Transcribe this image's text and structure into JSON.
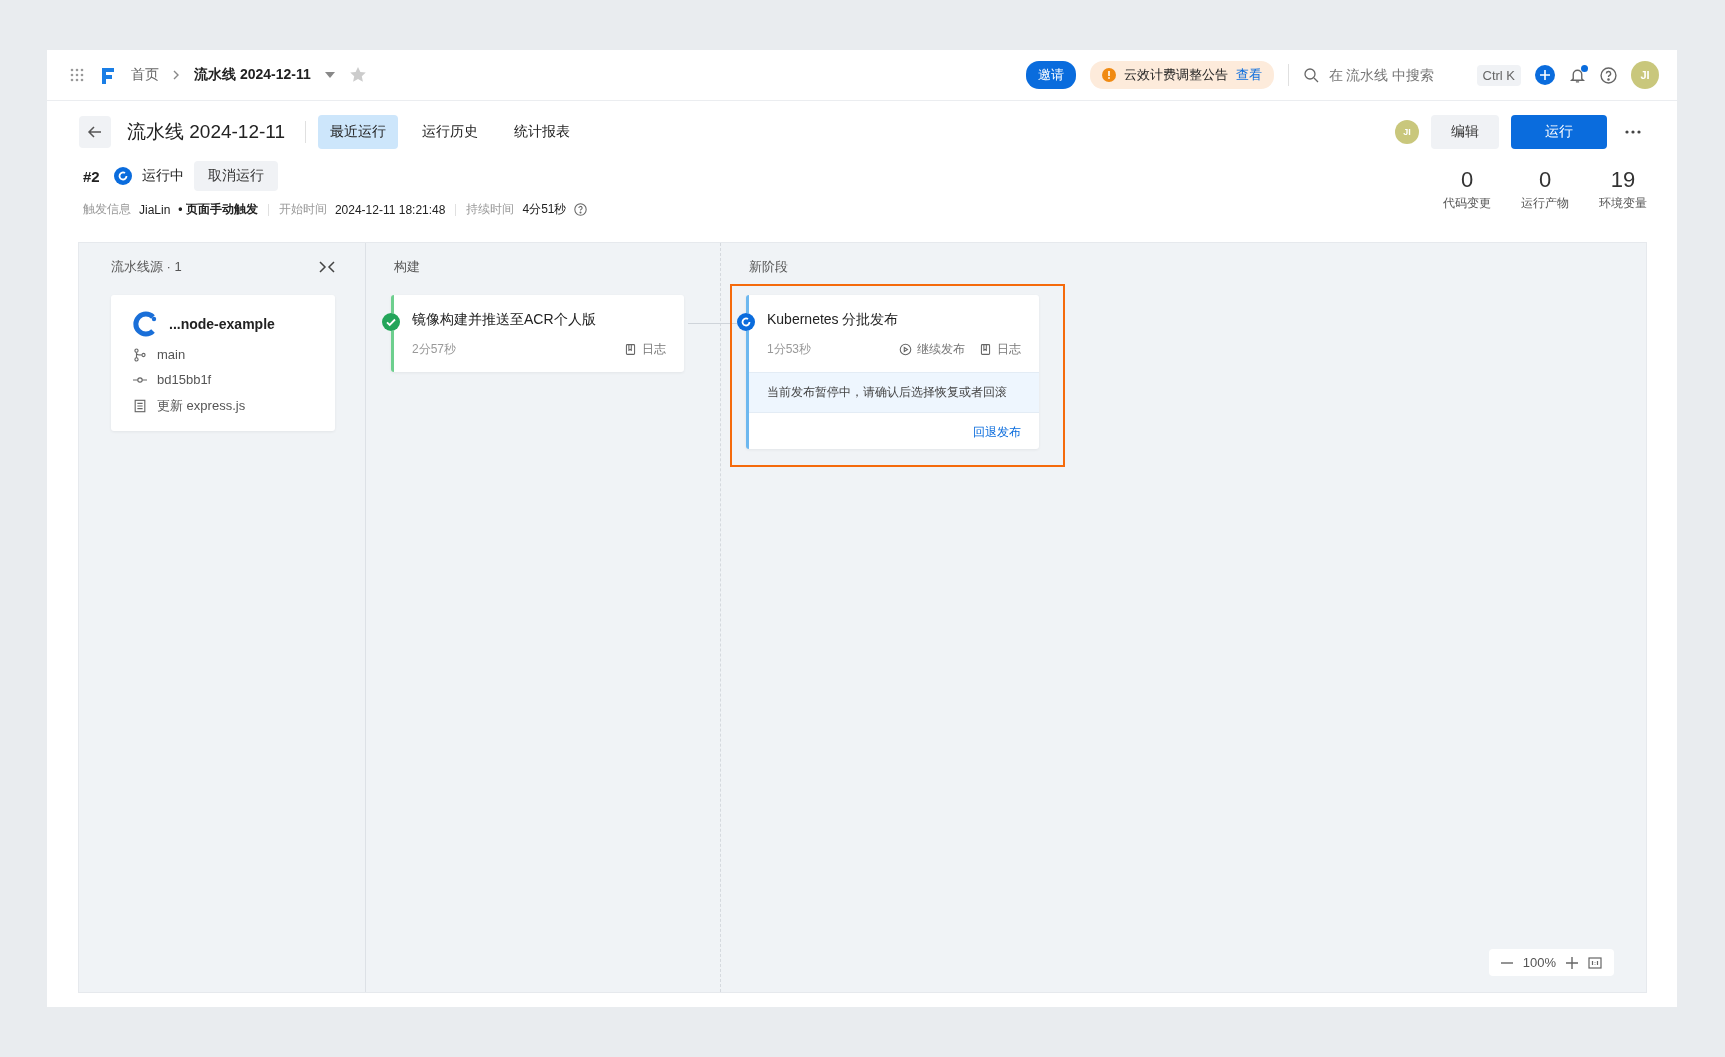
{
  "topbar": {
    "breadcrumb": [
      {
        "text": "首页"
      },
      {
        "text": "流水线 2024-12-11"
      }
    ],
    "invite": "邀请",
    "notice": {
      "text": "云效计费调整公告",
      "link": "查看"
    },
    "search": {
      "placeholder": "在 流水线 中搜索"
    },
    "shortcut": "Ctrl K",
    "bell_unread": true,
    "avatar": "JI"
  },
  "header": {
    "title": "流水线 2024-12-11",
    "tabs": [
      {
        "label": "最近运行",
        "selected": true
      },
      {
        "label": "运行历史",
        "selected": false
      },
      {
        "label": "统计报表",
        "selected": false
      }
    ],
    "avatar": "JI",
    "edit": "编辑",
    "run": "运行"
  },
  "run": {
    "number": "#2",
    "status": "运行中",
    "cancel": "取消运行",
    "trigger": {
      "label": "触发信息",
      "user": "JiaLin",
      "method": "• 页面手动触发"
    },
    "start": {
      "label": "开始时间",
      "value": "2024-12-11 18:21:48"
    },
    "duration": {
      "label": "持续时间",
      "value": "4分51秒"
    }
  },
  "stats": [
    {
      "value": "0",
      "label": "代码变更"
    },
    {
      "value": "0",
      "label": "运行产物"
    },
    {
      "value": "19",
      "label": "环境变量"
    }
  ],
  "source": {
    "title": "流水线源 · 1",
    "repo": "...node-example",
    "branch": "main",
    "commit": "bd15bb1f",
    "message": "更新 express.js"
  },
  "stages": [
    {
      "title": "构建",
      "jobs": [
        {
          "name": "镜像构建并推送至ACR个人版",
          "kind": "success",
          "duration": "2分57秒",
          "highlighted": false,
          "actions": [
            {
              "kind": "log",
              "label": "日志"
            }
          ]
        }
      ]
    },
    {
      "title": "新阶段",
      "jobs": [
        {
          "name": "Kubernetes 分批发布",
          "kind": "running",
          "duration": "1分53秒",
          "highlighted": true,
          "actions": [
            {
              "kind": "play",
              "label": "继续发布"
            },
            {
              "kind": "log",
              "label": "日志"
            }
          ],
          "notice": "当前发布暂停中，请确认后选择恢复或者回滚",
          "footer_link": "回退发布"
        }
      ]
    }
  ],
  "zoom": {
    "level_text": "100%"
  }
}
